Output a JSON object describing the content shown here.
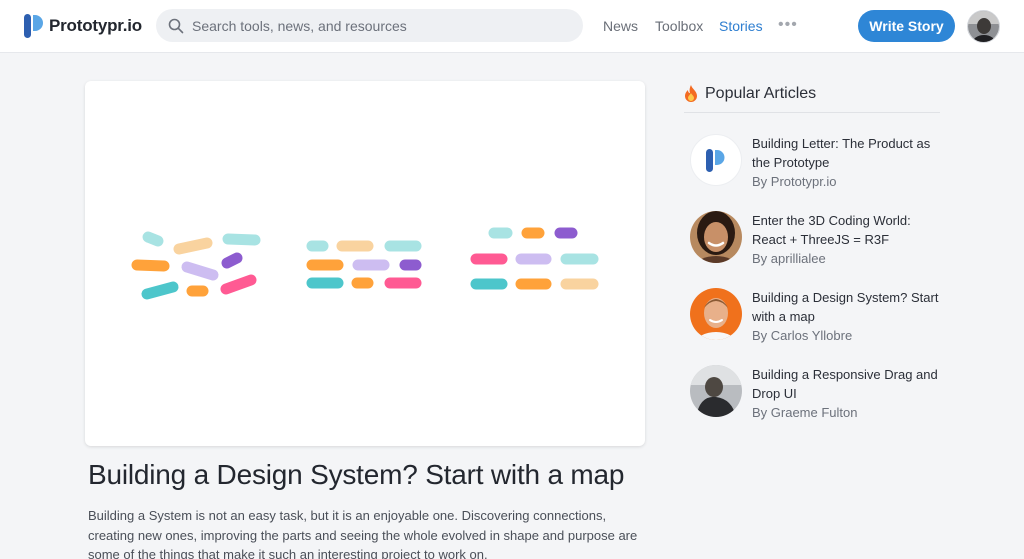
{
  "header": {
    "brand": "Prototypr.io",
    "search_placeholder": "Search tools, news, and resources",
    "nav": [
      {
        "label": "News",
        "active": false
      },
      {
        "label": "Toolbox",
        "active": false
      },
      {
        "label": "Stories",
        "active": true
      }
    ],
    "more_label": "•••",
    "write_button": "Write Story",
    "accent_color": "#2e86d6"
  },
  "hero": {
    "image": "design-system-map-illustration",
    "pill_colors": [
      "#a8e3e3",
      "#ffa23a",
      "#f9d39f",
      "#cdbdf1",
      "#8d5ccf",
      "#4dc6cb",
      "#ff5a93"
    ]
  },
  "article": {
    "title": "Building a Design System? Start with a map",
    "excerpt": "Building a System is not an easy task, but it is an enjoyable one. Discovering connections, creating new ones, improving the parts and seeing the whole evolved in shape and purpose are some of the things that make it such an interesting project to work on."
  },
  "sidebar": {
    "title": "Popular Articles",
    "icon": "fire-icon",
    "items": [
      {
        "title": "Building Letter: The Product as the Prototype",
        "author": "By Prototypr.io",
        "thumb": "prototypr-logo"
      },
      {
        "title": "Enter the 3D Coding World: React + ThreeJS = R3F",
        "author": "By aprillialee",
        "thumb": "author-avatar"
      },
      {
        "title": "Building a Design System? Start with a map",
        "author": "By Carlos Yllobre",
        "thumb": "author-avatar"
      },
      {
        "title": "Building a Responsive Drag and Drop UI",
        "author": "By Graeme Fulton",
        "thumb": "author-avatar"
      }
    ]
  }
}
